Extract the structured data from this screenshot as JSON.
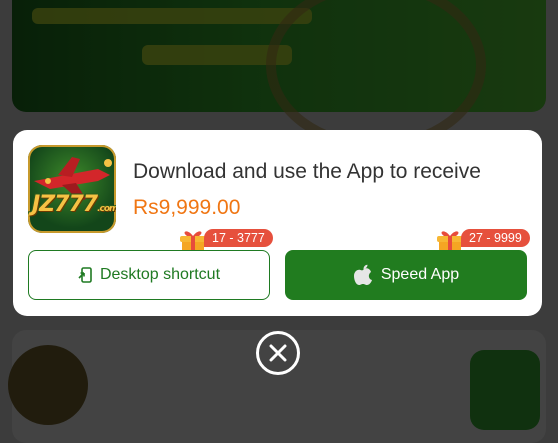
{
  "modal": {
    "title": "Download and use the App to receive",
    "amount": "Rs9,999.00",
    "logo_text": "JZ777",
    "logo_suffix": ".com"
  },
  "buttons": {
    "desktop_label": "Desktop shortcut",
    "desktop_badge": "17 - 3777",
    "speed_label": "Speed App",
    "speed_badge": "27 - 9999"
  },
  "icons": {
    "desktop": "shortcut-icon",
    "speed": "apple-icon",
    "gift": "gift-icon",
    "close": "close-icon"
  },
  "colors": {
    "accent_green": "#217c1f",
    "amount_orange": "#f07613",
    "badge_red": "#e6503d"
  }
}
